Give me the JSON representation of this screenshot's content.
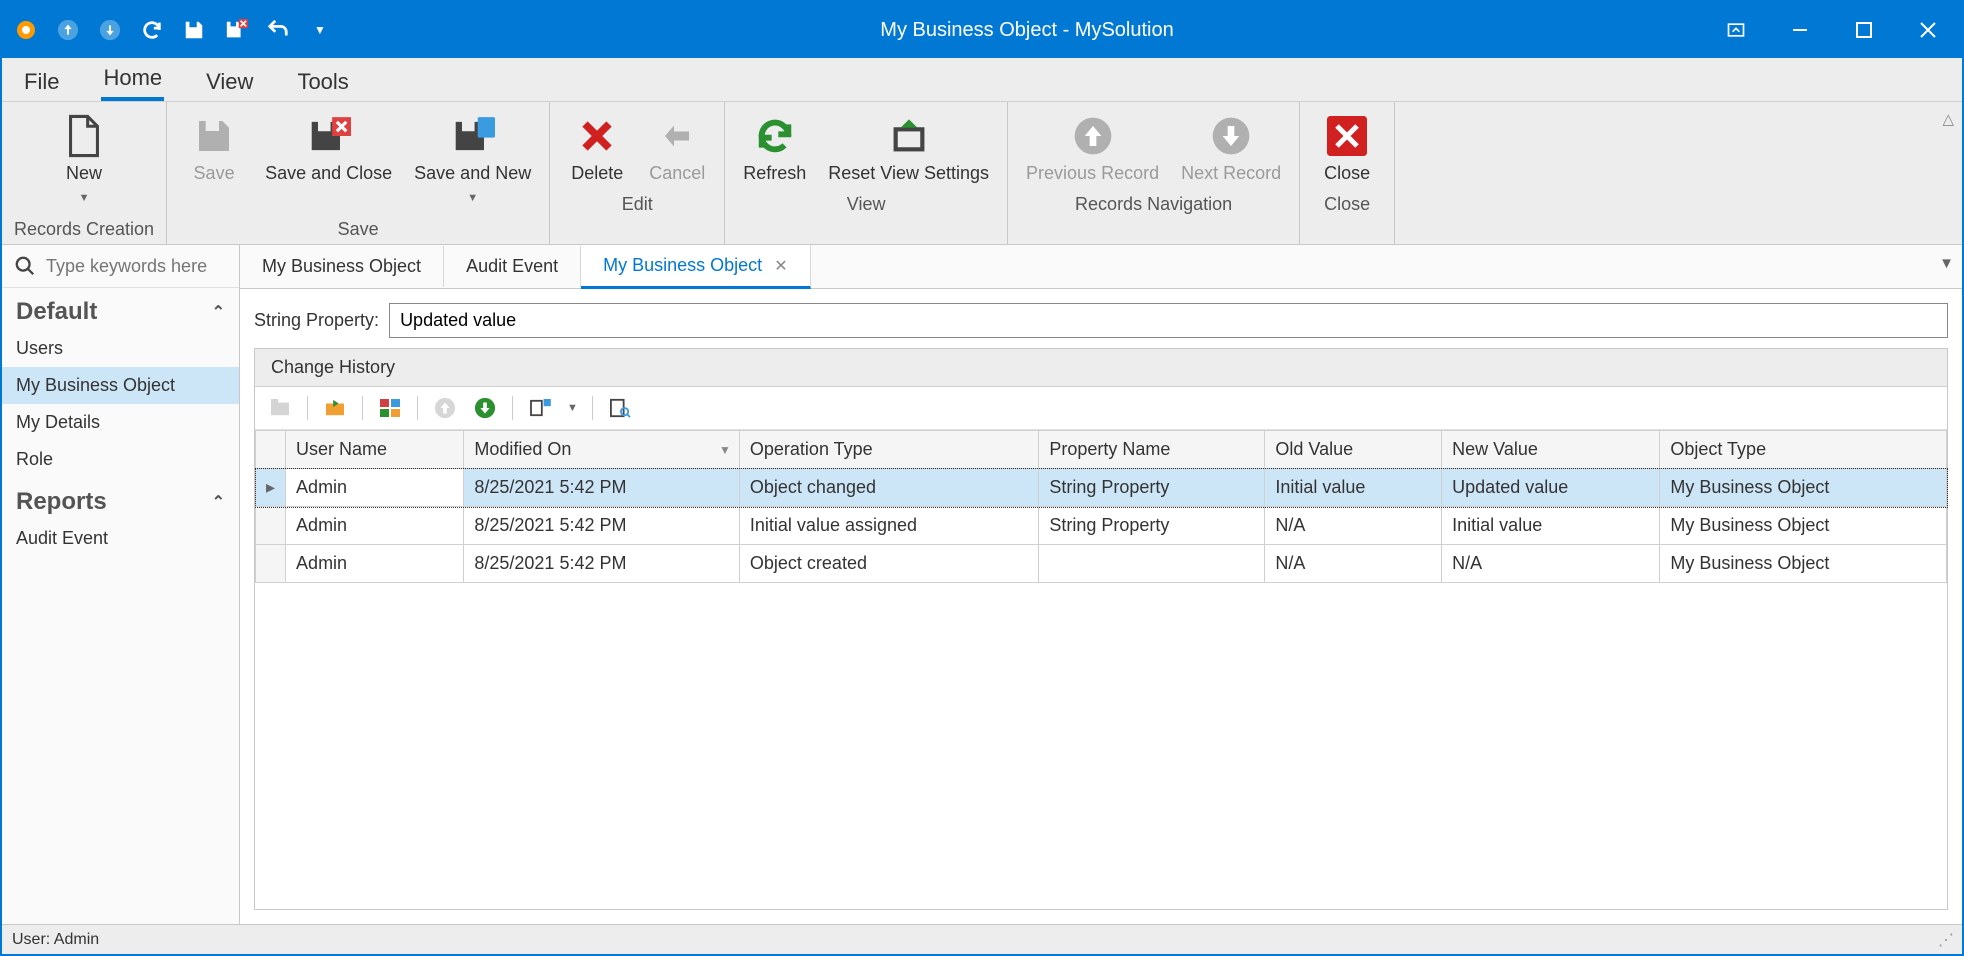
{
  "window": {
    "title": "My Business Object - MySolution"
  },
  "menu": {
    "tabs": [
      "File",
      "Home",
      "View",
      "Tools"
    ],
    "active": 1
  },
  "ribbon": {
    "groups": [
      {
        "label": "Records Creation",
        "buttons": [
          {
            "label": "New",
            "dropdown": true
          }
        ]
      },
      {
        "label": "Save",
        "buttons": [
          {
            "label": "Save",
            "gray": true
          },
          {
            "label": "Save and Close"
          },
          {
            "label": "Save and New",
            "dropdown": true
          }
        ]
      },
      {
        "label": "Edit",
        "buttons": [
          {
            "label": "Delete"
          },
          {
            "label": "Cancel",
            "gray": true
          }
        ]
      },
      {
        "label": "View",
        "buttons": [
          {
            "label": "Refresh"
          },
          {
            "label": "Reset View Settings"
          }
        ]
      },
      {
        "label": "Records Navigation",
        "buttons": [
          {
            "label": "Previous Record",
            "gray": true
          },
          {
            "label": "Next Record",
            "gray": true
          }
        ]
      },
      {
        "label": "Close",
        "buttons": [
          {
            "label": "Close"
          }
        ]
      }
    ]
  },
  "search": {
    "placeholder": "Type keywords here"
  },
  "nav": {
    "sections": [
      {
        "title": "Default",
        "items": [
          "Users",
          "My Business Object",
          "My Details",
          "Role"
        ],
        "activeIndex": 1
      },
      {
        "title": "Reports",
        "items": [
          "Audit Event"
        ],
        "activeIndex": -1
      }
    ]
  },
  "docTabs": {
    "tabs": [
      "My Business Object",
      "Audit Event",
      "My Business Object"
    ],
    "active": 2,
    "closableActive": true
  },
  "form": {
    "stringProperty_label": "String Property:",
    "stringProperty_value": "Updated value"
  },
  "grid": {
    "title": "Change History",
    "columns": [
      "User Name",
      "Modified On",
      "Operation Type",
      "Property Name",
      "Old Value",
      "New Value",
      "Object Type"
    ],
    "sortColumn": 1,
    "rows": [
      {
        "cells": [
          "Admin",
          "8/25/2021 5:42 PM",
          "Object changed",
          "String Property",
          "Initial value",
          "Updated value",
          "My Business Object"
        ],
        "selected": true
      },
      {
        "cells": [
          "Admin",
          "8/25/2021 5:42 PM",
          "Initial value assigned",
          "String Property",
          "N/A",
          "Initial value",
          "My Business Object"
        ],
        "selected": false
      },
      {
        "cells": [
          "Admin",
          "8/25/2021 5:42 PM",
          "Object created",
          "",
          "N/A",
          "N/A",
          "My Business Object"
        ],
        "selected": false
      }
    ]
  },
  "status": {
    "user": "User: Admin"
  }
}
